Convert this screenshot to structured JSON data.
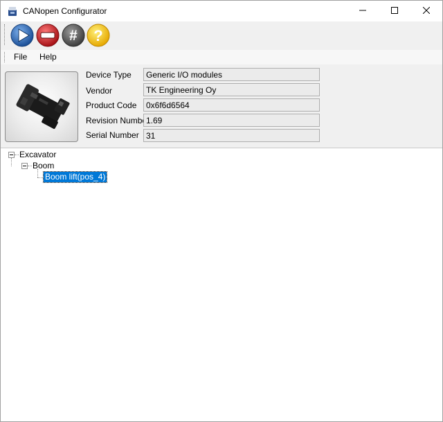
{
  "window": {
    "title": "CANopen Configurator",
    "controls": [
      "minimize-icon",
      "maximize-icon",
      "close-icon"
    ]
  },
  "toolbar": {
    "buttons": [
      {
        "icon": "play-icon",
        "color": "#1f5fa8"
      },
      {
        "icon": "stop-icon",
        "color": "#c0161c"
      },
      {
        "icon": "hash-icon",
        "color": "#5a5a5a"
      },
      {
        "icon": "help-icon",
        "color": "#f0c419"
      }
    ]
  },
  "menu": {
    "file": "File",
    "help": "Help"
  },
  "device": {
    "image": "device-photo",
    "fields": [
      {
        "label": "Device Type",
        "value": "Generic I/O modules"
      },
      {
        "label": "Vendor",
        "value": "TK Engineering Oy"
      },
      {
        "label": "Product Code",
        "value": "0x6f6d6564"
      },
      {
        "label": "Revision Number",
        "value": "1.69"
      },
      {
        "label": "Serial Number",
        "value": "31"
      }
    ]
  },
  "tree": {
    "root": "Excavator",
    "child": "Boom",
    "leaf": "Boom lift(pos_4)",
    "selection_color": "#0078d7"
  }
}
